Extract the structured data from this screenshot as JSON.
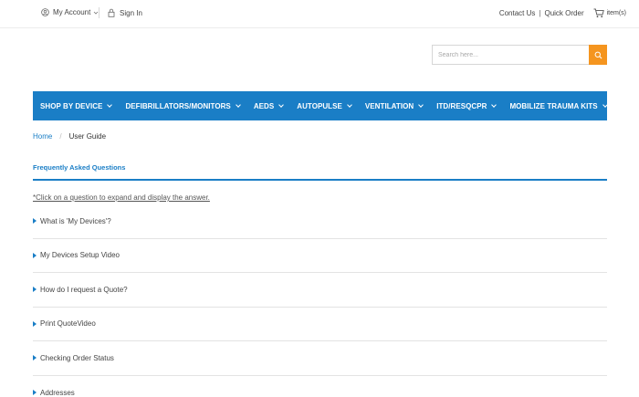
{
  "topbar": {
    "my_account": "My Account",
    "sign_in": "Sign In",
    "contact_us": "Contact Us",
    "separator": "|",
    "quick_order": "Quick Order",
    "cart_items": "item(s)"
  },
  "search": {
    "placeholder": "Search here..."
  },
  "nav": {
    "items": [
      {
        "label": "SHOP BY DEVICE"
      },
      {
        "label": "DEFIBRILLATORS/MONITORS"
      },
      {
        "label": "AEDS"
      },
      {
        "label": "AUTOPULSE"
      },
      {
        "label": "VENTILATION"
      },
      {
        "label": "ITD/RESQCPR"
      },
      {
        "label": "MOBILIZE TRAUMA KITS"
      }
    ]
  },
  "breadcrumb": {
    "home": "Home",
    "slash": "/",
    "current": "User Guide"
  },
  "faq": {
    "tab_label": "Frequently Asked Questions",
    "hint": "*Click on a question to expand and display the answer.",
    "questions": [
      "What is 'My Devices'?",
      "My Devices Setup Video",
      "How do I request a Quote?",
      "Print QuoteVideo",
      "Checking Order Status",
      "Addresses"
    ]
  },
  "colors": {
    "primary_blue": "#1a7ec6",
    "search_orange": "#f5951f"
  }
}
